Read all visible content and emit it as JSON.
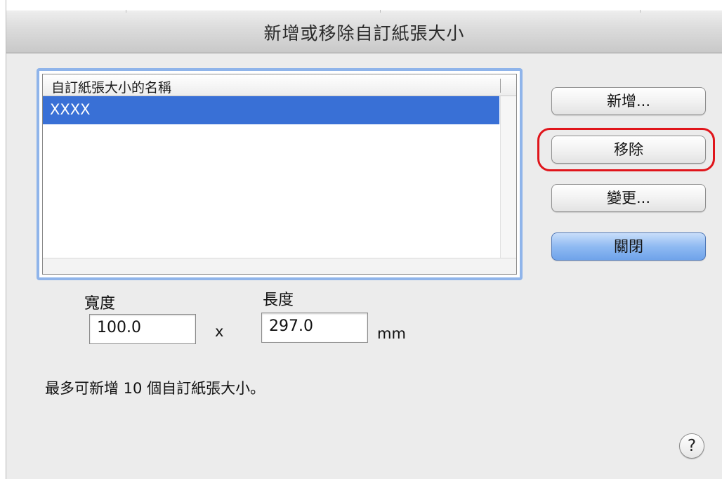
{
  "window": {
    "title": "新增或移除自訂紙張大小"
  },
  "list": {
    "column_header": "自訂紙張大小的名稱",
    "rows": [
      "XXXX"
    ],
    "selected_index": 0
  },
  "buttons": {
    "add_label": "新增...",
    "remove_label": "移除",
    "change_label": "變更...",
    "close_label": "關閉"
  },
  "size": {
    "width_label": "寬度",
    "width_value": "100.0",
    "separator": "x",
    "length_label": "長度",
    "length_value": "297.0",
    "unit": "mm"
  },
  "note": "最多可新增 10 個自訂紙張大小。",
  "help": {
    "label": "?",
    "icon": "question-mark-icon"
  },
  "colors": {
    "selection": "#3970d6",
    "default_button": "#8fbaf2",
    "focus_ring": "#8fb4ea",
    "highlight_annotation": "#e0151b"
  }
}
